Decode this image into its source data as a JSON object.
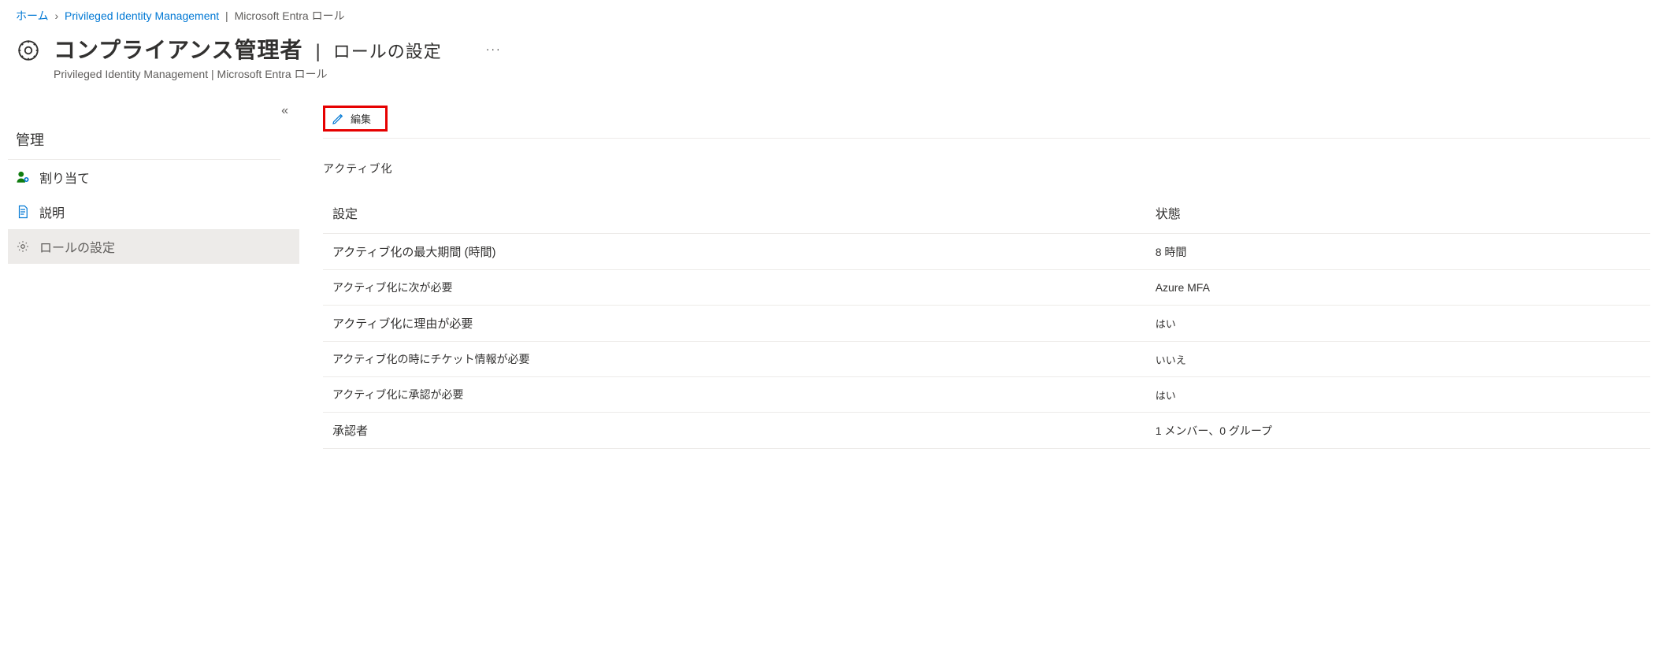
{
  "breadcrumb": {
    "home": "ホーム",
    "pim": "Privileged Identity Management",
    "pim_suffix": "Microsoft  Entra ロール"
  },
  "header": {
    "title": "コンプライアンス管理者",
    "subtitle_right": "ロールの設定",
    "subtitle": "Privileged Identity Management |  Microsoft Entra ロール",
    "ellipsis": "···"
  },
  "sidebar": {
    "collapse": "《",
    "heading": "管理",
    "items": [
      {
        "label": "割り当て"
      },
      {
        "label": "説明"
      },
      {
        "label": "ロールの設定"
      }
    ]
  },
  "toolbar": {
    "edit_label": "編集"
  },
  "main": {
    "section_title": "アクティブ化",
    "columns": {
      "setting": "設定",
      "state": "状態"
    },
    "rows": [
      {
        "setting": "アクティブ化の最大期間 (時間)",
        "state": "8 時間"
      },
      {
        "setting": "アクティブ化に次が必要",
        "state": "Azure MFA"
      },
      {
        "setting": "アクティブ化に理由が必要",
        "state": "はい"
      },
      {
        "setting": "アクティブ化の時にチケット情報が必要",
        "state": "いいえ"
      },
      {
        "setting": "アクティブ化に承認が必要",
        "state": "はい"
      },
      {
        "setting": "承認者",
        "state": "1 メンバー、0 グループ"
      }
    ]
  }
}
